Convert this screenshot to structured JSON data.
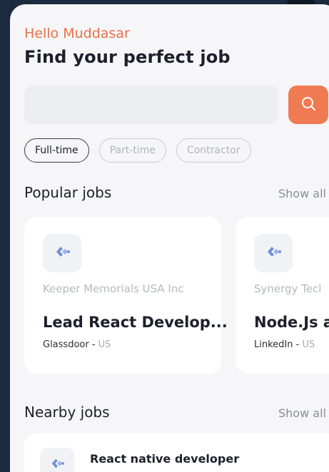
{
  "header": {
    "greeting": "Hello Muddasar",
    "title": "Find your perfect job"
  },
  "search": {
    "placeholder": "",
    "button_icon": "search-icon"
  },
  "filters": [
    {
      "label": "Full-time",
      "active": true
    },
    {
      "label": "Part-time",
      "active": false
    },
    {
      "label": "Contractor",
      "active": false
    }
  ],
  "popular": {
    "title": "Popular jobs",
    "show_all": "Show all",
    "jobs": [
      {
        "company": "Keeper Memorials USA Inc",
        "title": "Lead React Develop...",
        "source": "Glassdoor",
        "location": "US",
        "logo_icon": "company-logo-icon"
      },
      {
        "company": "Synergy Tecl",
        "title": "Node.Js a",
        "source": "LinkedIn",
        "location": "US",
        "logo_icon": "company-logo-icon"
      }
    ]
  },
  "nearby": {
    "title": "Nearby jobs",
    "show_all": "Show all",
    "jobs": [
      {
        "title": "React native developer",
        "logo_icon": "company-logo-icon"
      }
    ]
  },
  "colors": {
    "accent": "#f07a52",
    "greeting": "#e8704a",
    "background": "#f6f6f8",
    "outer": "#1b2a3f"
  }
}
